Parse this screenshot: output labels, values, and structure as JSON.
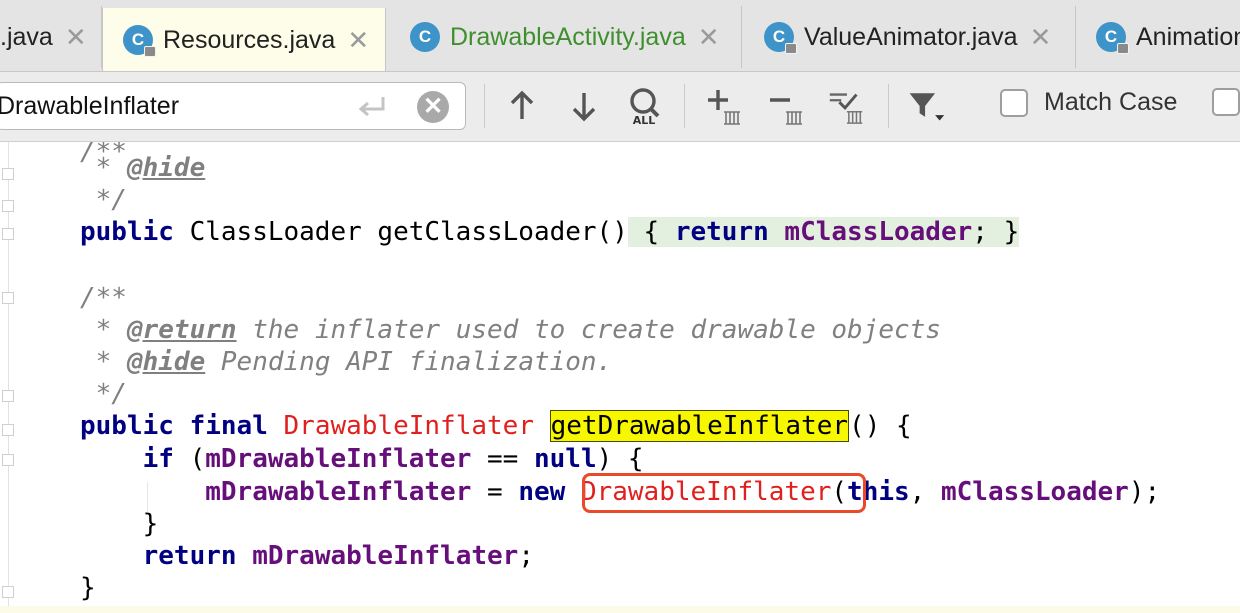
{
  "tabs": [
    {
      "label": ".java",
      "close": "✕",
      "active": false,
      "green": false
    },
    {
      "label": "Resources.java",
      "close": "✕",
      "active": true,
      "green": false
    },
    {
      "label": "DrawableActivity.java",
      "close": "✕",
      "active": false,
      "green": true
    },
    {
      "label": "ValueAnimator.java",
      "close": "✕",
      "active": false,
      "green": false
    },
    {
      "label": "Animation",
      "close": "",
      "active": false,
      "green": false
    }
  ],
  "tab_icon_letter": "C",
  "search": {
    "value": "DrawableInflater",
    "match_case_label": "Match Case",
    "match_case_checked": false,
    "all_badge": "ALL"
  },
  "toolbar_icons": [
    "previous-occurrence-icon",
    "next-occurrence-icon",
    "find-all-icon",
    "add-occurrence-icon",
    "remove-occurrence-icon",
    "select-all-occurrences-icon",
    "filter-icon"
  ],
  "code": {
    "line0": "/**",
    "line1": {
      "star": " * ",
      "tag": "@hide"
    },
    "line2": " */",
    "line3": {
      "kw": "public",
      "rest": " ClassLoader getClassLoader()",
      "brace_open": " {",
      "ret": "return",
      "field": "mClassLoader",
      "semi": ";",
      "brace_close": " }"
    },
    "line5": "/**",
    "line6": {
      "star": " * ",
      "tag": "@return",
      "text": " the inflater used to create drawable objects"
    },
    "line7": {
      "star": " * ",
      "tag": "@hide",
      "text": " Pending API finalization."
    },
    "line8": " */",
    "line9": {
      "kw1": "public",
      "kw2": "final",
      "type": "DrawableInflater",
      "method": "getDrawableInflater",
      "rest": "() {"
    },
    "line10": {
      "kw": "if",
      "open": " (",
      "field": "mDrawableInflater",
      "op": " == ",
      "null": "null",
      "close": ") {"
    },
    "line11": {
      "field": "mDrawableInflater",
      "op": " = ",
      "kw": "new",
      "type": "DrawableInflater",
      "paren": "(",
      "kwthis": "this",
      "comma": ", ",
      "field2": "mClassLoader",
      "end": ");"
    },
    "line12": "}",
    "line13": {
      "kw": "return",
      "field": "mDrawableInflater",
      "semi": ";"
    },
    "line14": "}"
  }
}
